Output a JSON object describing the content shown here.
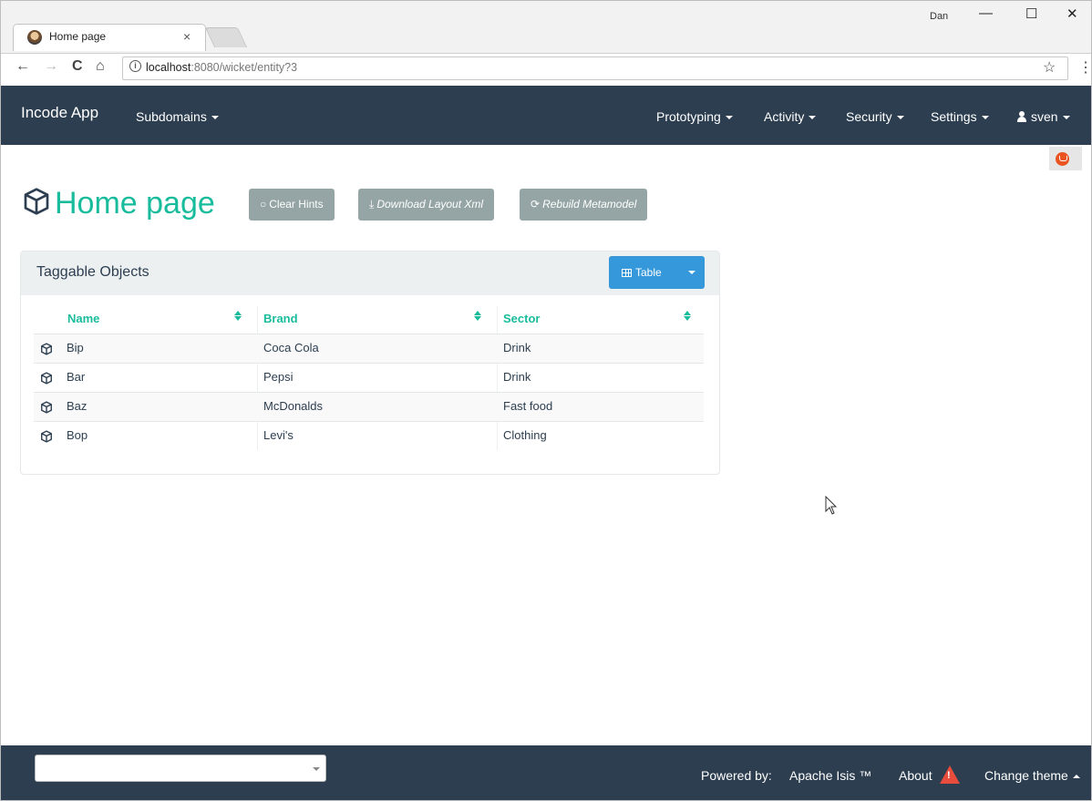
{
  "browser": {
    "tab_title": "Home page",
    "tab_close": "×",
    "window_user": "Dan",
    "window_minimize": "—",
    "window_maximize": "☐",
    "window_close": "✕",
    "back": "←",
    "forward": "→",
    "reload": "C",
    "home": "⌂",
    "info": "i",
    "url_host": "localhost",
    "url_rest": ":8080/wicket/entity?3",
    "bookmark": "☆",
    "menu": "⋮"
  },
  "navbar": {
    "brand": "Incode App",
    "left_items": [
      "Subdomains"
    ],
    "right_items": [
      "Prototyping",
      "Activity",
      "Security",
      "Settings"
    ],
    "user": "sven"
  },
  "page": {
    "title": "Home page",
    "actions": {
      "clear_hints": "Clear Hints",
      "download_layout": "Download Layout Xml",
      "rebuild_metamodel": "Rebuild Metamodel"
    }
  },
  "panel": {
    "title": "Taggable Objects",
    "view_button": "Table",
    "columns": [
      "Name",
      "Brand",
      "Sector"
    ],
    "rows": [
      {
        "name": "Bip",
        "brand": "Coca Cola",
        "sector": "Drink"
      },
      {
        "name": "Bar",
        "brand": "Pepsi",
        "sector": "Drink"
      },
      {
        "name": "Baz",
        "brand": "McDonalds",
        "sector": "Fast food"
      },
      {
        "name": "Bop",
        "brand": "Levi's",
        "sector": "Clothing"
      }
    ]
  },
  "footer": {
    "select_value": "",
    "powered_by": "Powered by:",
    "powered_link": "Apache Isis ™",
    "about": "About",
    "change_theme": "Change theme"
  },
  "colors": {
    "navbar": "#2c3e50",
    "accent": "#18bc9c",
    "primary_button": "#3498db",
    "grey_button": "#95a5a6",
    "warning": "#e74c3c"
  },
  "icons": {
    "tab_favicon": "user-avatar-icon",
    "object": "cube-icon",
    "user": "user-icon",
    "table_view": "table-grid-icon",
    "about_warning": "warning-triangle-icon"
  }
}
